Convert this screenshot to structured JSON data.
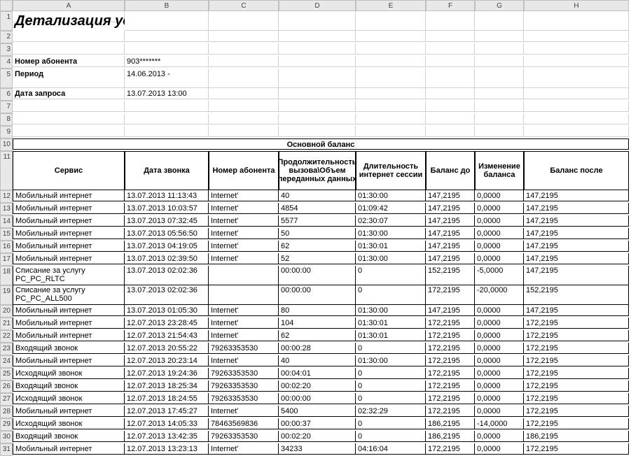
{
  "columns": [
    "A",
    "B",
    "C",
    "D",
    "E",
    "F",
    "G",
    "H"
  ],
  "title": "Детализация услуг связи",
  "meta": [
    {
      "label": "Номер абонента",
      "value": "903*******"
    },
    {
      "label": "Период",
      "value": "14.06.2013 -"
    },
    {
      "label": "Дата запроса",
      "value": "13.07.2013 13:00"
    }
  ],
  "section_title": "Основной баланс",
  "headers": [
    "Сервис",
    "Дата звонка",
    "Номер абонента",
    "Продолжительность вызова\\Объем переданных данных",
    "Длительность интернет сессии",
    "Баланс до",
    "Изменение баланса",
    "Баланс после"
  ],
  "rows_start": 12,
  "chart_data": {
    "type": "table",
    "rows": [
      [
        "Мобильный интернет",
        "13.07.2013 11:13:43",
        "Internet'",
        "40",
        "01:30:00",
        "147,2195",
        "0,0000",
        "147,2195"
      ],
      [
        "Мобильный интернет",
        "13.07.2013 10:03:57",
        "Internet'",
        "4854",
        "01:09:42",
        "147,2195",
        "0,0000",
        "147,2195"
      ],
      [
        "Мобильный интернет",
        "13.07.2013 07:32:45",
        "Internet'",
        "5577",
        "02:30:07",
        "147,2195",
        "0,0000",
        "147,2195"
      ],
      [
        "Мобильный интернет",
        "13.07.2013 05:56:50",
        "Internet'",
        "50",
        "01:30:00",
        "147,2195",
        "0,0000",
        "147,2195"
      ],
      [
        "Мобильный интернет",
        "13.07.2013 04:19:05",
        "Internet'",
        "62",
        "01:30:01",
        "147,2195",
        "0,0000",
        "147,2195"
      ],
      [
        "Мобильный интернет",
        "13.07.2013 02:39:50",
        "Internet'",
        "52",
        "01:30:00",
        "147,2195",
        "0,0000",
        "147,2195"
      ],
      [
        "Списание за услугу PC_PC_RLTC",
        "13.07.2013 02:02:36",
        "",
        "00:00:00",
        "0",
        "152,2195",
        "-5,0000",
        "147,2195"
      ],
      [
        "Списание за услугу PC_PC_ALL500",
        "13.07.2013 02:02:36",
        "",
        "00:00:00",
        "0",
        "172,2195",
        "-20,0000",
        "152,2195"
      ],
      [
        "Мобильный интернет",
        "13.07.2013 01:05:30",
        "Internet'",
        "80",
        "01:30:00",
        "147,2195",
        "0,0000",
        "147,2195"
      ],
      [
        "Мобильный интернет",
        "12.07.2013 23:28:45",
        "Internet'",
        "104",
        "01:30:01",
        "172,2195",
        "0,0000",
        "172,2195"
      ],
      [
        "Мобильный интернет",
        "12.07.2013 21:54:43",
        "Internet'",
        "62",
        "01:30:01",
        "172,2195",
        "0,0000",
        "172,2195"
      ],
      [
        "Входящий звонок",
        "12.07.2013 20:55:22",
        "79263353530",
        "00:00:28",
        "0",
        "172,2195",
        "0,0000",
        "172,2195"
      ],
      [
        "Мобильный интернет",
        "12.07.2013 20:23:14",
        "Internet'",
        "40",
        "01:30:00",
        "172,2195",
        "0,0000",
        "172,2195"
      ],
      [
        "Исходящий звонок",
        "12.07.2013 19:24:36",
        "79263353530",
        "00:04:01",
        "0",
        "172,2195",
        "0,0000",
        "172,2195"
      ],
      [
        "Входящий звонок",
        "12.07.2013 18:25:34",
        "79263353530",
        "00:02:20",
        "0",
        "172,2195",
        "0,0000",
        "172,2195"
      ],
      [
        "Исходящий звонок",
        "12.07.2013 18:24:55",
        "79263353530",
        "00:00:00",
        "0",
        "172,2195",
        "0,0000",
        "172,2195"
      ],
      [
        "Мобильный интернет",
        "12.07.2013 17:45:27",
        "Internet'",
        "5400",
        "02:32:29",
        "172,2195",
        "0,0000",
        "172,2195"
      ],
      [
        "Исходящий звонок",
        "12.07.2013 14:05:33",
        "78463569836",
        "00:00:37",
        "0",
        "186,2195",
        "-14,0000",
        "172,2195"
      ],
      [
        "Входящий звонок",
        "12.07.2013 13:42:35",
        "79263353530",
        "00:02:20",
        "0",
        "186,2195",
        "0,0000",
        "186,2195"
      ],
      [
        "Мобильный интернет",
        "12.07.2013 13:23:13",
        "Internet'",
        "34233",
        "04:16:04",
        "172,2195",
        "0,0000",
        "172,2195"
      ]
    ]
  }
}
